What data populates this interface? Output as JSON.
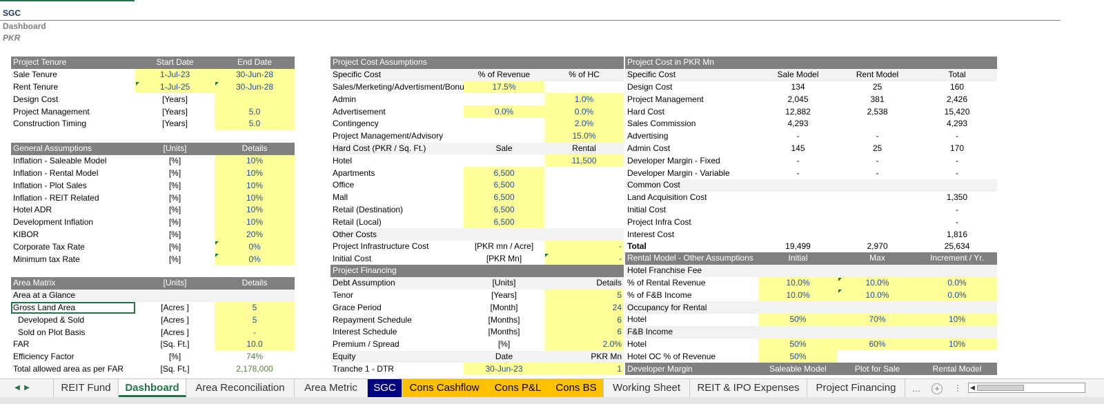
{
  "header": {
    "company": "SGC",
    "sheet": "Dashboard",
    "currency": "PKR"
  },
  "tenure": {
    "headers": [
      "Project Tenure",
      "Start Date",
      "End Date"
    ],
    "rows": [
      [
        "Sale Tenure",
        "1-Jul-23",
        "30-Jun-28"
      ],
      [
        "Rent Tenure",
        "1-Jul-25",
        "30-Jun-28"
      ],
      [
        "Design Cost",
        "[Years]",
        ""
      ],
      [
        "Project Management",
        "[Years]",
        "5.0"
      ],
      [
        "Construction Timing",
        "[Years]",
        "5.0"
      ]
    ]
  },
  "general": {
    "headers": [
      "General Assumptions",
      "[Units]",
      "Details"
    ],
    "rows": [
      [
        "Inflation - Saleable Model",
        "[%]",
        "10%"
      ],
      [
        "Inflation - Rental Model",
        "[%]",
        "10%"
      ],
      [
        "Inflation - Plot Sales",
        "[%]",
        "10%"
      ],
      [
        "Inflation - REIT Related",
        "[%]",
        "10%"
      ],
      [
        "Hotel ADR",
        "[%]",
        "10%"
      ],
      [
        "Development Inflation",
        "[%]",
        "10%"
      ],
      [
        "KIBOR",
        "[%]",
        "20%"
      ],
      [
        "Corporate Tax Rate",
        "[%]",
        "0%"
      ],
      [
        "Minimum tax Rate",
        "[%]",
        "0%"
      ]
    ]
  },
  "area": {
    "headers": [
      "Area Matrix",
      "[Units]",
      "Details"
    ],
    "section": "Area at a Glance",
    "rows": [
      [
        "Gross Land Area",
        "[Acres ]",
        "5"
      ],
      [
        "Developed & Sold",
        "[Acres ]",
        "5"
      ],
      [
        "Sold on Plot Basis",
        "[Acres ]",
        "-"
      ],
      [
        "FAR",
        "[Sq. Ft.]",
        "10.0"
      ],
      [
        "Efficiency Factor",
        "[%]",
        "74%"
      ],
      [
        "Total allowed area as per FAR",
        "[Sq. Ft.]",
        "2,178,000"
      ]
    ]
  },
  "cost_assump": {
    "headers": [
      "Project Cost Assumptions"
    ],
    "sub": [
      "Specific Cost",
      "% of Revenue",
      "% of HC"
    ],
    "rows": [
      [
        "Sales/Merketing/Advertisment/Bonus",
        "17.5%",
        ""
      ],
      [
        "Admin",
        "",
        "1.0%"
      ],
      [
        "Advertisement",
        "0.0%",
        "0.0%"
      ],
      [
        "Contingency",
        "",
        "2.0%"
      ],
      [
        "Project Management/Advisory",
        "",
        "15.0%"
      ]
    ],
    "hard_sub": [
      "Hard Cost (PKR / Sq. Ft.)",
      "Sale",
      "Rental"
    ],
    "hard_rows": [
      [
        "Hotel",
        "",
        "11,500"
      ],
      [
        "Apartments",
        "6,500",
        ""
      ],
      [
        "Office",
        "6,500",
        ""
      ],
      [
        "Mall",
        "6,500",
        ""
      ],
      [
        "Retail (Destination)",
        "6,500",
        ""
      ],
      [
        "Retail (Local)",
        "6,500",
        ""
      ]
    ],
    "other_title": "Other Costs",
    "other_rows": [
      [
        "Project Infrastructure Cost",
        "[PKR mn / Acre]",
        "-"
      ],
      [
        "Initial Cost",
        "[PKR Mn]",
        "-"
      ]
    ]
  },
  "financing": {
    "title": "Project Financing",
    "sub": [
      "Debt Assumption",
      "[Units]",
      "Details"
    ],
    "rows": [
      [
        "Tenor",
        "[Years]",
        "5"
      ],
      [
        "Grace Period",
        "[Month]",
        "24"
      ],
      [
        "Repayment Schedule",
        "[Months]",
        "6"
      ],
      [
        "Interest Schedule",
        "[Months]",
        "6"
      ],
      [
        "Premium / Spread",
        "[%]",
        "2.0%"
      ]
    ],
    "equity_sub": [
      "Equity",
      "Date",
      "PKR Mn"
    ],
    "equity_rows": [
      [
        "Tranche 1 - DTR",
        "30-Jun-23",
        "1"
      ]
    ]
  },
  "cost_pkr": {
    "title": "Project Cost in PKR  Mn",
    "sub": [
      "Specific Cost",
      "Sale Model",
      "Rent Model",
      "Total"
    ],
    "rows": [
      [
        "Design Cost",
        "134",
        "25",
        "160"
      ],
      [
        "Project Management",
        "2,045",
        "381",
        "2,426"
      ],
      [
        "Hard Cost",
        "12,882",
        "2,538",
        "15,420"
      ],
      [
        "Sales Commission",
        "4,293",
        "",
        "4,293"
      ],
      [
        "Advertising",
        "-",
        "-",
        "-"
      ],
      [
        "Admin Cost",
        "145",
        "25",
        "170"
      ],
      [
        "Developer Margin - Fixed",
        "-",
        "-",
        "-"
      ],
      [
        "Developer Margin - Variable",
        "-",
        "-",
        "-"
      ]
    ],
    "common_title": "Common Cost",
    "common_rows": [
      [
        "Land Acquisition Cost",
        "",
        "",
        "1,350"
      ],
      [
        "Initial Cost",
        "",
        "",
        "-"
      ],
      [
        "Project Infra Cost",
        "",
        "",
        "-"
      ],
      [
        "Interest Cost",
        "",
        "",
        "1,816"
      ]
    ],
    "total": [
      "Total",
      "19,499",
      "2,970",
      "25,634"
    ]
  },
  "rental": {
    "headers": [
      "Rental Model - Other Assumptions",
      "Initial",
      "Max",
      "Increment / Yr."
    ],
    "franchise_title": "Hotel Franchise Fee",
    "franchise_rows": [
      [
        "% of Rental Revenue",
        "10.0%",
        "10.0%",
        "0.0%"
      ],
      [
        "% of F&B Income",
        "10.0%",
        "10.0%",
        "0.0%"
      ]
    ],
    "occ_title": "Occupancy for Rental",
    "occ_rows": [
      [
        "Hotel",
        "50%",
        "70%",
        "10%"
      ]
    ],
    "fb_title": "F&B Income",
    "fb_rows": [
      [
        "Hotel",
        "50%",
        "60%",
        "10%"
      ],
      [
        "Hotel OC % of Revenue",
        "50%",
        "",
        ""
      ]
    ],
    "margin_headers": [
      "Developer Margin",
      "Saleable Model",
      "Plot for Sale",
      "Rental Model"
    ]
  },
  "tabs": [
    "REIT Fund",
    "Dashboard",
    "Area Reconciliation",
    "Area Metric",
    "SGC",
    "Cons Cashflow",
    "Cons P&L",
    "Cons BS",
    "Working Sheet",
    "REIT & IPO Expenses",
    "Project Financing"
  ],
  "tab_more": "...",
  "tab_add": "+"
}
